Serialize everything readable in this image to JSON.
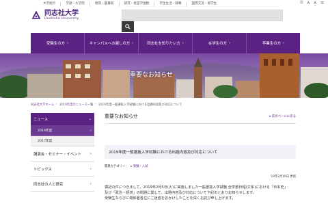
{
  "utility": {
    "links": [
      "大学紹介",
      "学部・大学院",
      "教育・図書館",
      "研究・産官学連携",
      "学生生活・就職",
      "国際交流・留学生"
    ],
    "tools": [
      "⚿",
      "A",
      "A̲",
      "☰"
    ]
  },
  "header": {
    "logo_ja": "同志社大学",
    "logo_en": "Doshisha University",
    "search_placeholder": ""
  },
  "nav": {
    "items": [
      "受験生の方",
      "キャンパスへお越しの方",
      "同志社を知りたい方",
      "在学生の方",
      "卒業生の方"
    ]
  },
  "hero": {
    "title": "重要なお知らせ"
  },
  "breadcrumb": [
    "同志社大学ホーム",
    "2019年度のニュース一覧",
    "2019年度一般選抜入学試験における出題内容及び対応について"
  ],
  "sidebar": {
    "news": "ニュース",
    "year2019": "2019年度",
    "year2017": "2017年度",
    "lectures": "講演会・セミナー・イベント",
    "topics": "トピックス",
    "people": "同志社の人と研究"
  },
  "main": {
    "heading": "重要なお知らせ",
    "back_link": "前のページに戻る",
    "article_title": "2019年度一般選抜入学試験における出題内容及び対応について",
    "category_label": "関連カテゴリー：",
    "category_value": "受験・入試",
    "date": "'19年2月19日 更新",
    "paragraphs": [
      "標記の件につきまして、2019年2月5日(火)に実施しました一般選抜入学試験 全学部日程(文系)における「日本史」",
      "及び「政治・経済」の問題に関して、出題内容及び対応について下記のとおりお知らせします。",
      "受験生ならびに関係者各位にご迷惑をおかけしたことを深くお詫び申し上げます。"
    ]
  },
  "colors": {
    "brand": "#5c2283",
    "nav_border": "#7d4aa3"
  }
}
